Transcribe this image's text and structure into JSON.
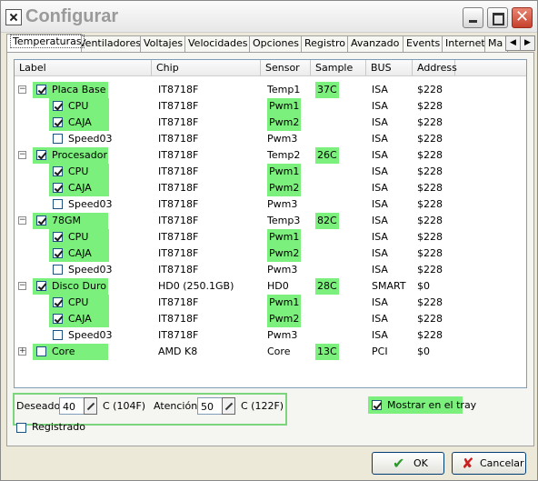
{
  "window": {
    "title": "Configurar"
  },
  "tabs": [
    "Temperaturas",
    "Ventiladores",
    "Voltajes",
    "Velocidades",
    "Opciones",
    "Registro",
    "Avanzado",
    "Events",
    "Internet",
    "Ma"
  ],
  "tab_scroll": {
    "left": "◀",
    "right": "▶"
  },
  "table": {
    "headers": [
      "Label",
      "Chip",
      "Sensor",
      "Sample",
      "BUS",
      "Address"
    ],
    "rows": [
      {
        "label": "Placa Base",
        "chip": "IT8718F",
        "sensor": "Temp1",
        "sample": "37C",
        "bus": "ISA",
        "address": "$228"
      },
      {
        "label": "CPU",
        "chip": "IT8718F",
        "sensor": "Pwm1",
        "sample": "",
        "bus": "ISA",
        "address": "$228"
      },
      {
        "label": "CAJA",
        "chip": "IT8718F",
        "sensor": "Pwm2",
        "sample": "",
        "bus": "ISA",
        "address": "$228"
      },
      {
        "label": "Speed03",
        "chip": "IT8718F",
        "sensor": "Pwm3",
        "sample": "",
        "bus": "ISA",
        "address": "$228"
      },
      {
        "label": "Procesador",
        "chip": "IT8718F",
        "sensor": "Temp2",
        "sample": "26C",
        "bus": "ISA",
        "address": "$228"
      },
      {
        "label": "CPU",
        "chip": "IT8718F",
        "sensor": "Pwm1",
        "sample": "",
        "bus": "ISA",
        "address": "$228"
      },
      {
        "label": "CAJA",
        "chip": "IT8718F",
        "sensor": "Pwm2",
        "sample": "",
        "bus": "ISA",
        "address": "$228"
      },
      {
        "label": "Speed03",
        "chip": "IT8718F",
        "sensor": "Pwm3",
        "sample": "",
        "bus": "ISA",
        "address": "$228"
      },
      {
        "label": "78GM",
        "chip": "IT8718F",
        "sensor": "Temp3",
        "sample": "82C",
        "bus": "ISA",
        "address": "$228"
      },
      {
        "label": "CPU",
        "chip": "IT8718F",
        "sensor": "Pwm1",
        "sample": "",
        "bus": "ISA",
        "address": "$228"
      },
      {
        "label": "CAJA",
        "chip": "IT8718F",
        "sensor": "Pwm2",
        "sample": "",
        "bus": "ISA",
        "address": "$228"
      },
      {
        "label": "Speed03",
        "chip": "IT8718F",
        "sensor": "Pwm3",
        "sample": "",
        "bus": "ISA",
        "address": "$228"
      },
      {
        "label": "Disco Duro",
        "chip": "HD0 (250.1GB)",
        "sensor": "HD0",
        "sample": "28C",
        "bus": "SMART",
        "address": "$0"
      },
      {
        "label": "CPU",
        "chip": "IT8718F",
        "sensor": "Pwm1",
        "sample": "",
        "bus": "ISA",
        "address": "$228"
      },
      {
        "label": "CAJA",
        "chip": "IT8718F",
        "sensor": "Pwm2",
        "sample": "",
        "bus": "ISA",
        "address": "$228"
      },
      {
        "label": "Speed03",
        "chip": "IT8718F",
        "sensor": "Pwm3",
        "sample": "",
        "bus": "ISA",
        "address": "$228"
      },
      {
        "label": "Core",
        "chip": "AMD K8",
        "sensor": "Core",
        "sample": "13C",
        "bus": "PCI",
        "address": "$0"
      }
    ]
  },
  "deseado": {
    "label": "Deseado",
    "value": "40",
    "unit": "C (104F)"
  },
  "atencion": {
    "label": "Atención",
    "value": "50",
    "unit": "C (122F)"
  },
  "mostrar_tray": {
    "label": "Mostrar en el tray"
  },
  "registrado": {
    "label": "Registrado"
  },
  "buttons": {
    "ok": "OK",
    "cancel": "Cancelar"
  },
  "colors": {
    "highlight": "#7cf07c",
    "ok_icon": "#2a9a2a",
    "cancel_icon": "#cc2020"
  }
}
